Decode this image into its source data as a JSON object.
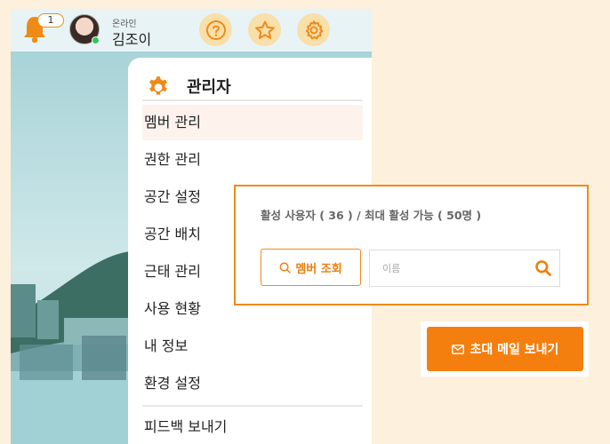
{
  "header": {
    "notification_count": "1",
    "status": "온라인",
    "user_name": "김조이",
    "icons": [
      "bell-icon",
      "help-icon",
      "star-icon",
      "gear-icon"
    ]
  },
  "menu": {
    "title": "관리자",
    "items": [
      {
        "label": "멤버 관리",
        "active": true
      },
      {
        "label": "권한 관리"
      },
      {
        "label": "공간 설정"
      },
      {
        "label": "공간 배치"
      },
      {
        "label": "근태 관리"
      },
      {
        "label": "사용 현황"
      },
      {
        "label": "내 정보"
      },
      {
        "label": "환경 설정"
      },
      {
        "label": "피드백 보내기"
      }
    ]
  },
  "member_panel": {
    "active_info": "활성 사용자 ( 36 ) / 최대 활성 가능 ( 50명 )",
    "search_button": "멤버 조회",
    "name_placeholder": "이름"
  },
  "invite": {
    "label": "초대 메일 보내기"
  },
  "colors": {
    "accent": "#f08a17",
    "button": "#f47f0f",
    "page_bg": "#fdf0dc",
    "online": "#2fc25b"
  }
}
